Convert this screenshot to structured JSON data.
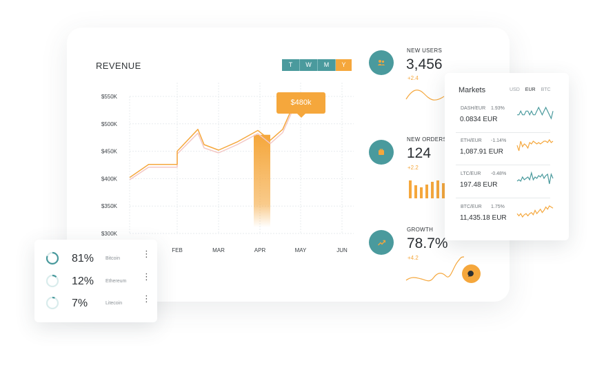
{
  "revenue": {
    "title": "REVENUE",
    "periods": [
      "T",
      "W",
      "M",
      "Y"
    ],
    "active_period": "Y",
    "tooltip": "$480k"
  },
  "chart_data": {
    "type": "line",
    "title": "REVENUE",
    "categories": [
      "FEB",
      "MAR",
      "APR",
      "MAY",
      "JUN"
    ],
    "y_ticks": [
      "$550K",
      "$500K",
      "$450K",
      "$400K",
      "$350K",
      "$300K"
    ],
    "ylim": [
      300,
      550
    ],
    "grid": true,
    "series": [
      {
        "x": [
          0,
          0.4,
          1,
          1,
          2,
          2.3,
          3,
          3.9,
          4.9,
          5.5,
          6.1,
          6.5,
          6.8
        ],
        "values": [
          402,
          426,
          426,
          450,
          490,
          462,
          452,
          467,
          488,
          470,
          490,
          524,
          550
        ],
        "color": "#f5a73c"
      },
      {
        "x": [
          0,
          0.4,
          1,
          1,
          2,
          2.3,
          3,
          3.9,
          4.9,
          5.5,
          6.1,
          6.5,
          6.8
        ],
        "values": [
          398,
          421,
          421,
          445,
          483,
          456,
          447,
          462,
          482,
          464,
          484,
          518,
          544
        ],
        "color": "#f3c7c4"
      }
    ],
    "highlight": {
      "x": 5.1,
      "value": 480
    }
  },
  "stats": [
    {
      "label": "NEW USERS",
      "value": "3,456",
      "change": "+2.4",
      "icon": "users-icon"
    },
    {
      "label": "NEW ORDERS",
      "value": "124",
      "change": "+2.2",
      "icon": "orders-icon"
    },
    {
      "label": "GROWTH",
      "value": "78.7%",
      "change": "+4.2",
      "icon": "growth-icon"
    }
  ],
  "markets": {
    "title": "Markets",
    "currencies": [
      "USD",
      "EUR",
      "BTC"
    ],
    "active_currency": "EUR",
    "rows": [
      {
        "pair": "DASH/EUR",
        "change": "1.93%",
        "price": "0.0834",
        "unit": "EUR",
        "color": "#4a9a9d",
        "spark": [
          5,
          5,
          6,
          5,
          5,
          6,
          6,
          5,
          6,
          5,
          5,
          6,
          7,
          6,
          5,
          6,
          7,
          6,
          5,
          4,
          6
        ]
      },
      {
        "pair": "ETH/EUR",
        "change": "-1.14%",
        "price": "1,087.91",
        "unit": "EUR",
        "color": "#f5a73c",
        "spark": [
          6,
          2,
          9,
          5,
          7,
          6,
          4,
          8,
          7,
          9,
          8,
          7,
          8,
          7,
          8,
          9,
          9,
          8,
          10,
          8,
          9
        ]
      },
      {
        "pair": "LTC/EUR",
        "change": "-0.48%",
        "price": "197.48",
        "unit": "EUR",
        "color": "#4a9a9d",
        "spark": [
          6,
          7,
          6,
          9,
          7,
          8,
          9,
          7,
          12,
          7,
          9,
          8,
          10,
          9,
          11,
          8,
          10,
          11,
          4,
          11,
          8
        ]
      },
      {
        "pair": "BTC/EUR",
        "change": "1.75%",
        "price": "11,435.18",
        "unit": "EUR",
        "color": "#f5a73c",
        "spark": [
          6,
          4,
          6,
          3,
          5,
          6,
          4,
          6,
          7,
          5,
          9,
          6,
          8,
          10,
          7,
          9,
          12,
          10,
          13,
          12,
          11
        ]
      }
    ]
  },
  "crypto": [
    {
      "pct": "81%",
      "name": "Bitcoin",
      "fraction": 0.81
    },
    {
      "pct": "12%",
      "name": "Ethereum",
      "fraction": 0.12
    },
    {
      "pct": "7%",
      "name": "Litecoin",
      "fraction": 0.07
    }
  ],
  "colors": {
    "accent": "#f5a73c",
    "teal": "#4a9a9d",
    "grid": "#e7ebee"
  }
}
